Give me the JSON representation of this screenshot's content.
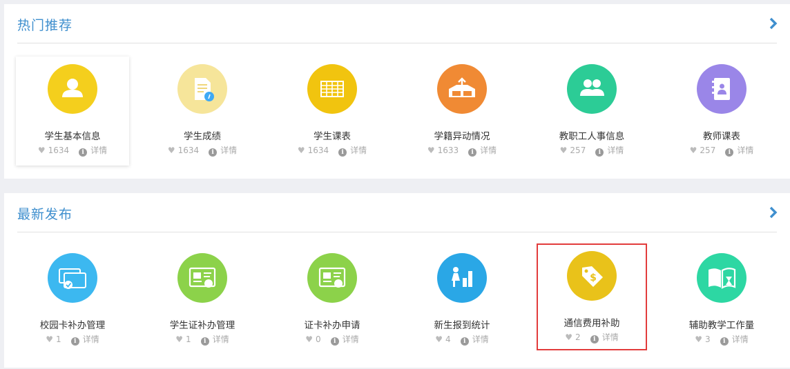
{
  "sections": [
    {
      "title": "热门推荐",
      "items": [
        {
          "name": "学生基本信息",
          "likes": "1634",
          "detail": "详情",
          "color": "#f4cf1d",
          "icon": "user-icon"
        },
        {
          "name": "学生成绩",
          "likes": "1634",
          "detail": "详情",
          "color": "#f6e59a",
          "icon": "document-icon"
        },
        {
          "name": "学生课表",
          "likes": "1634",
          "detail": "详情",
          "color": "#f1c40f",
          "icon": "table-icon"
        },
        {
          "name": "学籍异动情况",
          "likes": "1633",
          "detail": "详情",
          "color": "#f08a34",
          "icon": "box-icon"
        },
        {
          "name": "教职工人事信息",
          "likes": "257",
          "detail": "详情",
          "color": "#2ccc96",
          "icon": "people-icon"
        },
        {
          "name": "教师课表",
          "likes": "257",
          "detail": "详情",
          "color": "#9a86e8",
          "icon": "notebook-icon"
        }
      ]
    },
    {
      "title": "最新发布",
      "items": [
        {
          "name": "校园卡补办管理",
          "likes": "1",
          "detail": "详情",
          "color": "#3cb8f0",
          "icon": "cards-icon"
        },
        {
          "name": "学生证补办管理",
          "likes": "1",
          "detail": "详情",
          "color": "#8cd24a",
          "icon": "id-card-icon"
        },
        {
          "name": "证卡补办申请",
          "likes": "0",
          "detail": "详情",
          "color": "#8cd24a",
          "icon": "id-card-icon"
        },
        {
          "name": "新生报到统计",
          "likes": "4",
          "detail": "详情",
          "color": "#2aa7e6",
          "icon": "bar-chart-icon"
        },
        {
          "name": "通信费用补助",
          "likes": "2",
          "detail": "详情",
          "color": "#e9c21a",
          "icon": "price-tag-icon"
        },
        {
          "name": "辅助教学工作量",
          "likes": "3",
          "detail": "详情",
          "color": "#2dd7a3",
          "icon": "book-icon"
        }
      ]
    }
  ],
  "colors": {
    "title": "#3f8fce",
    "highlight": "#e23b3b",
    "background": "#eeeff3"
  }
}
